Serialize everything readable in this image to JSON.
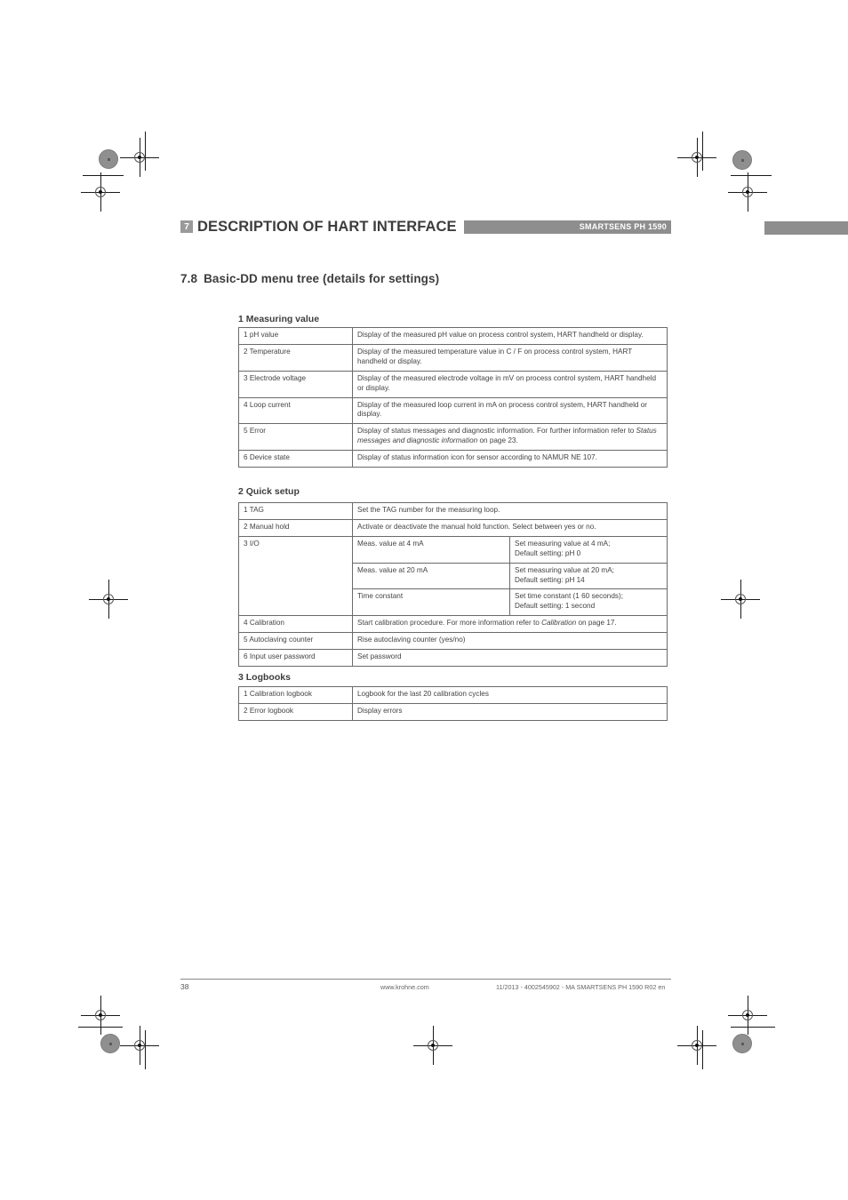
{
  "header": {
    "chapter_number": "7",
    "chapter_title": "DESCRIPTION OF HART INTERFACE",
    "product_tag": "SMARTSENS PH 1590"
  },
  "section": {
    "number": "7.8",
    "title": "Basic-DD menu tree (details for settings)"
  },
  "groups": [
    {
      "label": "1 Measuring value",
      "rows": [
        {
          "key": "1 pH value",
          "desc": "Display of the measured pH value on process control system, HART handheld or display."
        },
        {
          "key": "2 Temperature",
          "desc": "Display of the measured temperature value in  C /  F on process control system, HART   handheld or display."
        },
        {
          "key": "3 Electrode voltage",
          "desc": "Display of the measured electrode voltage in mV on process control system, HART   handheld or display."
        },
        {
          "key": "4 Loop current",
          "desc": "Display of the measured loop current in mA on process control system, HART   handheld or display."
        },
        {
          "key": "5 Error",
          "desc_pre": "Display of status messages and diagnostic information. For further information refer to ",
          "desc_em": "Status messages and diagnostic information",
          "desc_post": " on page 23."
        },
        {
          "key": "6 Device state",
          "desc": "Display of status information icon for sensor according to NAMUR NE 107."
        }
      ]
    },
    {
      "label": "2 Quick setup",
      "rows": [
        {
          "key": "1 TAG",
          "desc": "Set the TAG number for the measuring loop."
        },
        {
          "key": "2 Manual hold",
          "desc": "Activate or deactivate the manual hold function. Select between yes or no."
        },
        {
          "key": "3 I/O",
          "sub": [
            {
              "name": "Meas. value at 4 mA",
              "desc": "Set measuring value at 4 mA;\nDefault setting: pH 0"
            },
            {
              "name": "Meas. value at 20 mA",
              "desc": "Set measuring value at 20 mA;\nDefault setting: pH 14"
            },
            {
              "name": "Time constant",
              "desc": "Set time constant (1   60 seconds);\nDefault setting: 1 second"
            }
          ]
        },
        {
          "key": "4 Calibration",
          "desc_pre": "Start calibration procedure. For more information refer to ",
          "desc_em": "Calibration",
          "desc_post": " on page 17."
        },
        {
          "key": "5 Autoclaving counter",
          "desc": "Rise autoclaving counter (yes/no)"
        },
        {
          "key": "6 Input user password",
          "desc": "Set password"
        }
      ]
    },
    {
      "label": "3 Logbooks",
      "rows": [
        {
          "key": "1 Calibration logbook",
          "desc": "Logbook for the last 20 calibration cycles"
        },
        {
          "key": "2 Error logbook",
          "desc": "Display errors"
        }
      ]
    }
  ],
  "footer": {
    "page_number": "38",
    "url": "www.krohne.com",
    "reference": "11/2013 - 4002545902 - MA SMARTSENS PH 1590 R02 en"
  },
  "colors": {
    "header_bar": "#8e8e8e",
    "badge": "#9a9a9a",
    "text": "#3d3d3d",
    "rule": "#6a6a6a"
  }
}
